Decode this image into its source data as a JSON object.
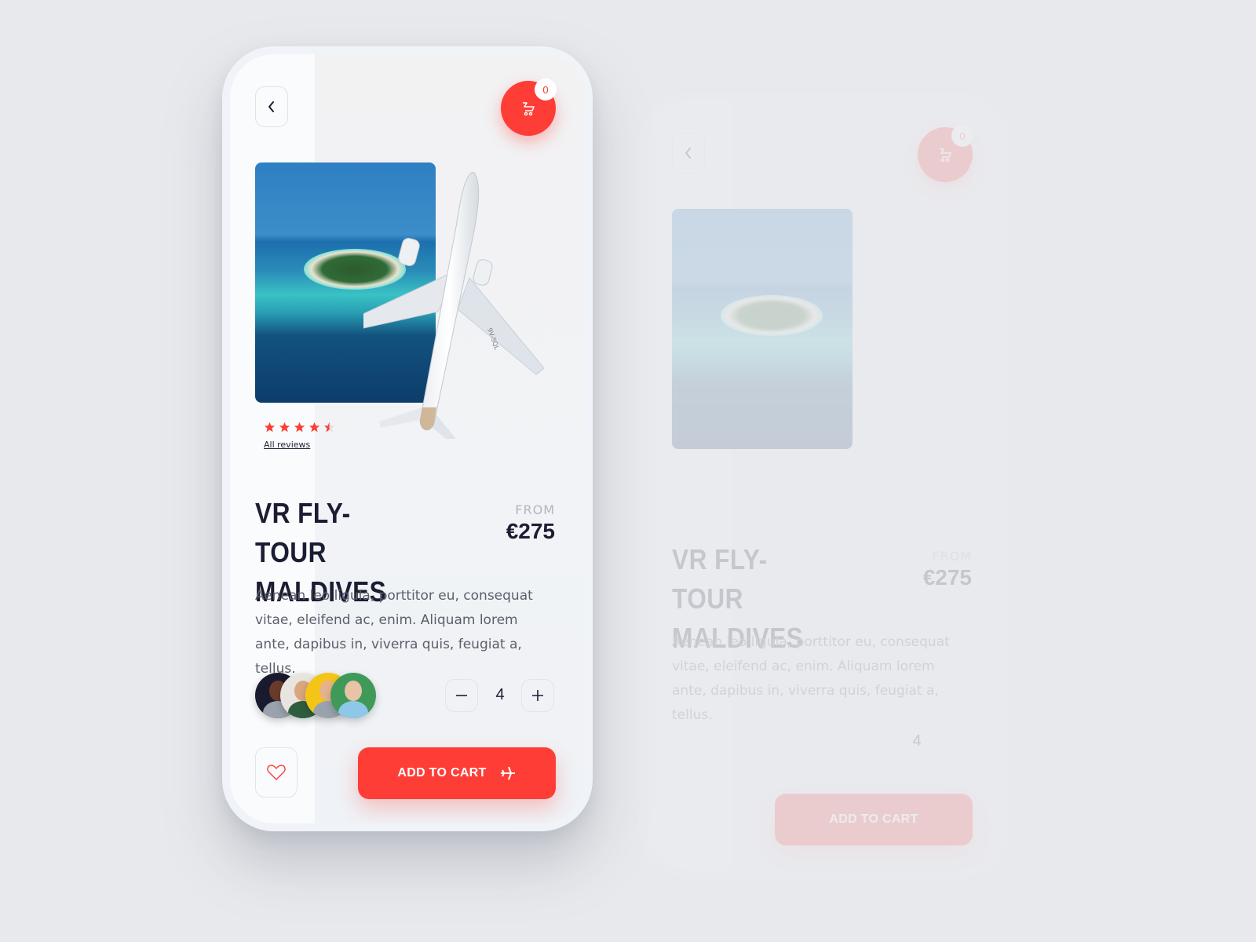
{
  "header": {
    "back_icon": "chevron-left-icon",
    "cart_icon": "cart-icon",
    "cart_count": "0"
  },
  "hero": {
    "image_alt": "Maldives island aerial view",
    "plane_registration": "9V-SQL"
  },
  "rating": {
    "value": 4.5,
    "max": 5,
    "reviews_link": "All reviews"
  },
  "product": {
    "title_line1": "VR FLY-TOUR",
    "title_line2": "MALDIVES",
    "price_label": "FROM",
    "price": "€275",
    "description": "Aenean leo ligula, porttitor eu, consequat vitae, eleifend ac, enim. Aliquam lorem ante, dapibus in, viverra quis, feugiat a, tellus."
  },
  "participants": {
    "avatars": [
      {
        "name": "avatar-1",
        "color": "#1a1a2e"
      },
      {
        "name": "avatar-2",
        "color": "#e8e4df"
      },
      {
        "name": "avatar-3",
        "color": "#f4c516"
      },
      {
        "name": "avatar-4",
        "color": "#3f9a5a"
      }
    ]
  },
  "quantity": {
    "value": "4",
    "minus_icon": "minus-icon",
    "plus_icon": "plus-icon"
  },
  "actions": {
    "favorite_icon": "heart-icon",
    "add_to_cart_label": "ADD TO CART",
    "add_to_cart_icon": "airplane-icon"
  },
  "colors": {
    "accent": "#fe3d36",
    "title": "#1b1d33",
    "text": "#5c5f6a",
    "background": "#e8e9ed"
  }
}
